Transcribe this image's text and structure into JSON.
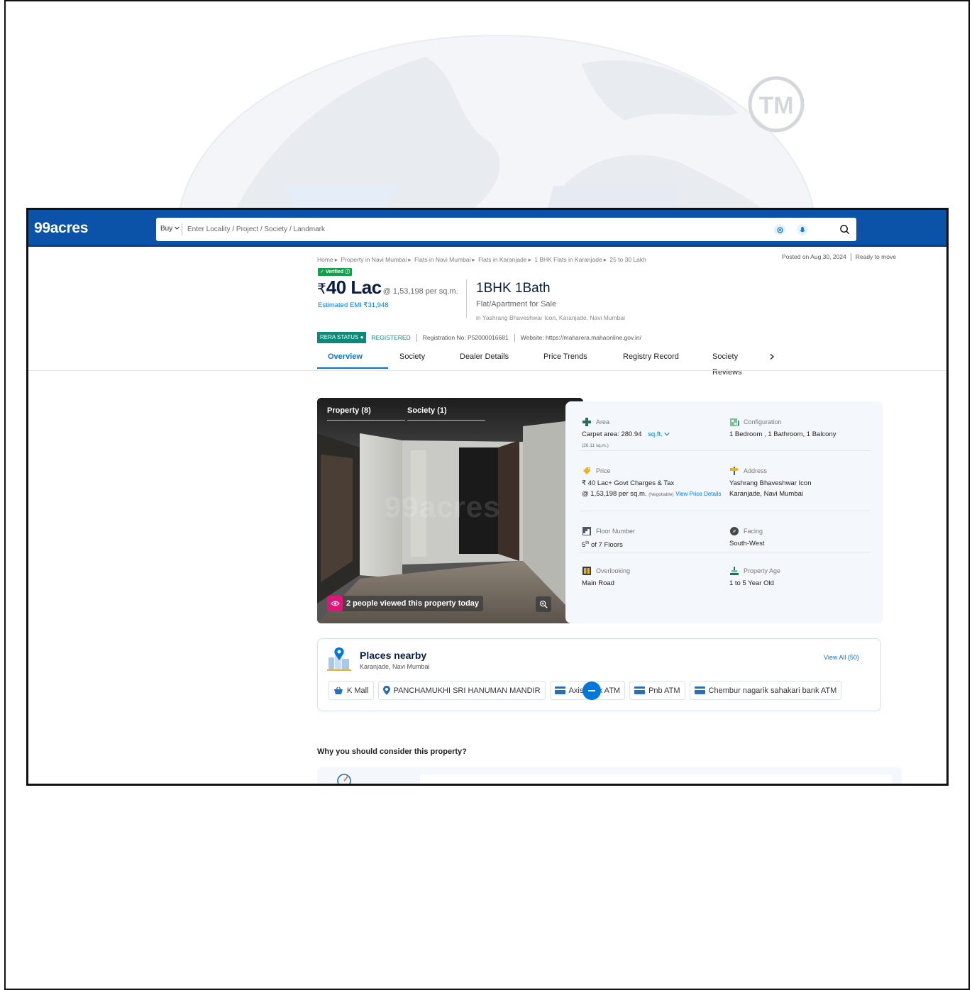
{
  "header": {
    "logo": "99acres",
    "buy_label": "Buy",
    "search_placeholder": "Enter Locality / Project / Society / Landmark"
  },
  "watermark": {
    "tm_text": "TM"
  },
  "breadcrumb": [
    "Home",
    "Property in Navi Mumbai",
    "Flats in Navi Mumbai",
    "Flats in Karanjade",
    "1 BHK Flats in Karanjade",
    "25 to 30 Lakh"
  ],
  "posted": {
    "date": "Posted on Aug 30, 2024",
    "status": "Ready to move"
  },
  "listing": {
    "verified": "Verified",
    "rupee": "₹",
    "price": "40 Lac",
    "per_sqm": "@ 1,53,198 per sq.m.",
    "emi": "Estimated EMI ₹31,948",
    "title": "1BHK 1Bath",
    "subtitle": "Flat/Apartment for Sale",
    "location": "in Yashrang Bhaveshwar Icon, Karanjade, Navi Mumbai"
  },
  "rera": {
    "badge": "RERA STATUS",
    "status": "REGISTERED",
    "registration": "Registration No: P52000016681",
    "website": "Website: https://maharera.mahaonline.gov.in/"
  },
  "tabs": [
    "Overview",
    "Society",
    "Dealer Details",
    "Price Trends",
    "Registry Record",
    "Society Reviews"
  ],
  "gallery": {
    "tab_property": "Property (8)",
    "tab_society": "Society (1)",
    "watermark": "99acres",
    "views": "2 people viewed this property today"
  },
  "details": {
    "area": {
      "label": "Area",
      "value": "Carpet area: 280.94",
      "unit": "sq.ft.",
      "sub": "(26.11 sq.m.)"
    },
    "configuration": {
      "label": "Configuration",
      "value": "1 Bedroom , 1 Bathroom, 1 Balcony"
    },
    "price": {
      "label": "Price",
      "line1": "₹ 40 Lac+ Govt Charges & Tax",
      "line2": "@ 1,53,198 per sq.m.",
      "negotiable": "(Negotiable)",
      "link": "View Price Details"
    },
    "address": {
      "label": "Address",
      "line1": "Yashrang Bhaveshwar Icon",
      "line2": "Karanjade, Navi Mumbai"
    },
    "floor": {
      "label": "Floor Number",
      "floor": "5",
      "sup": "th",
      "rest": "of 7 Floors"
    },
    "facing": {
      "label": "Facing",
      "value": "South-West"
    },
    "overlooking": {
      "label": "Overlooking",
      "value": "Main Road"
    },
    "age": {
      "label": "Property Age",
      "value": "1 to 5 Year Old"
    }
  },
  "places": {
    "title": "Places nearby",
    "subtitle": "Karanjade, Navi Mumbai",
    "view_all": "View All (50)",
    "chips": [
      {
        "icon": "shopping-basket-icon",
        "label": "K Mall"
      },
      {
        "icon": "location-pin-icon",
        "label": "PANCHAMUKHI SRI HANUMAN MANDIR"
      },
      {
        "icon": "atm-card-icon",
        "label": "Axis bank ATM"
      },
      {
        "icon": "atm-card-icon",
        "label": "Pnb ATM"
      },
      {
        "icon": "atm-card-icon",
        "label": "Chembur nagarik sahakari bank ATM"
      }
    ]
  },
  "why": {
    "title": "Why you should consider this property?"
  },
  "colors": {
    "brand": "#0A53A8",
    "link": "#0078DB",
    "verified": "#12A04A",
    "rera": "#0B8A7A",
    "views": "#E0157A"
  }
}
